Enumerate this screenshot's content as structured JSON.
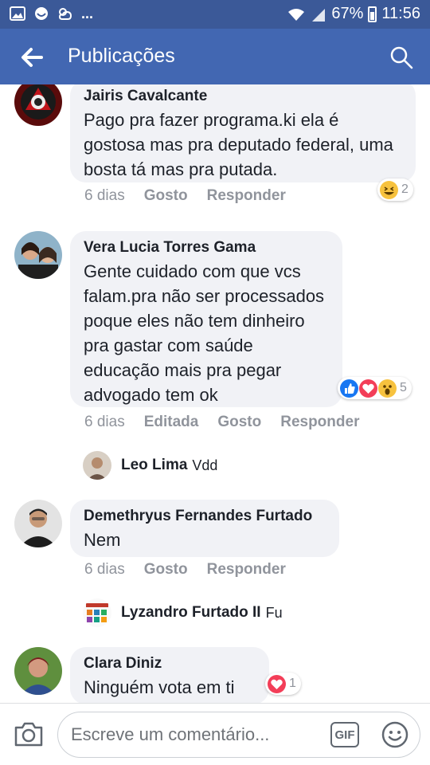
{
  "status_bar": {
    "dots": "...",
    "battery": "67%",
    "time": "11:56"
  },
  "app_bar": {
    "title": "Publicações"
  },
  "comments": [
    {
      "author": "Jairis Cavalcante",
      "text": "Pago pra fazer programa.ki ela é gostosa mas pra deputado federal, uma bosta tá mas pra putada.",
      "time": "6 dias",
      "like": "Gosto",
      "reply": "Responder",
      "reaction_icons": [
        "laugh-reaction-icon"
      ],
      "reaction_count": "2"
    },
    {
      "author": "Vera Lucia Torres Gama",
      "text": "Gente cuidado com que vcs falam.pra não ser processados poque eles não tem dinheiro pra gastar com saúde educação mais pra pegar advogado tem ok",
      "time": "6 dias",
      "edited": "Editada",
      "like": "Gosto",
      "reply": "Responder",
      "reaction_icons": [
        "like-reaction-icon",
        "love-reaction-icon",
        "wow-reaction-icon"
      ],
      "reaction_count": "5",
      "reply_preview": {
        "name": "Leo Lima",
        "text": "Vdd"
      }
    },
    {
      "author": "Demethryus Fernandes Furtado",
      "text": "Nem",
      "time": "6 dias",
      "like": "Gosto",
      "reply": "Responder",
      "reply_preview": {
        "name": "Lyzandro Furtado II",
        "text": "Fu"
      }
    },
    {
      "author": "Clara Diniz",
      "text": "Ninguém vota em ti",
      "reaction_icons": [
        "love-reaction-icon"
      ],
      "reaction_count": "1"
    }
  ],
  "composer": {
    "placeholder": "Escreve um comentário...",
    "gif_label": "GIF"
  },
  "colors": {
    "status_bar": "#3b5998",
    "app_bar": "#4267b2",
    "bubble": "#f1f2f6",
    "meta_text": "#90949c",
    "like_blue": "#1877f2",
    "love_red": "#f33e58",
    "emoji_yellow": "#f7c23e"
  }
}
